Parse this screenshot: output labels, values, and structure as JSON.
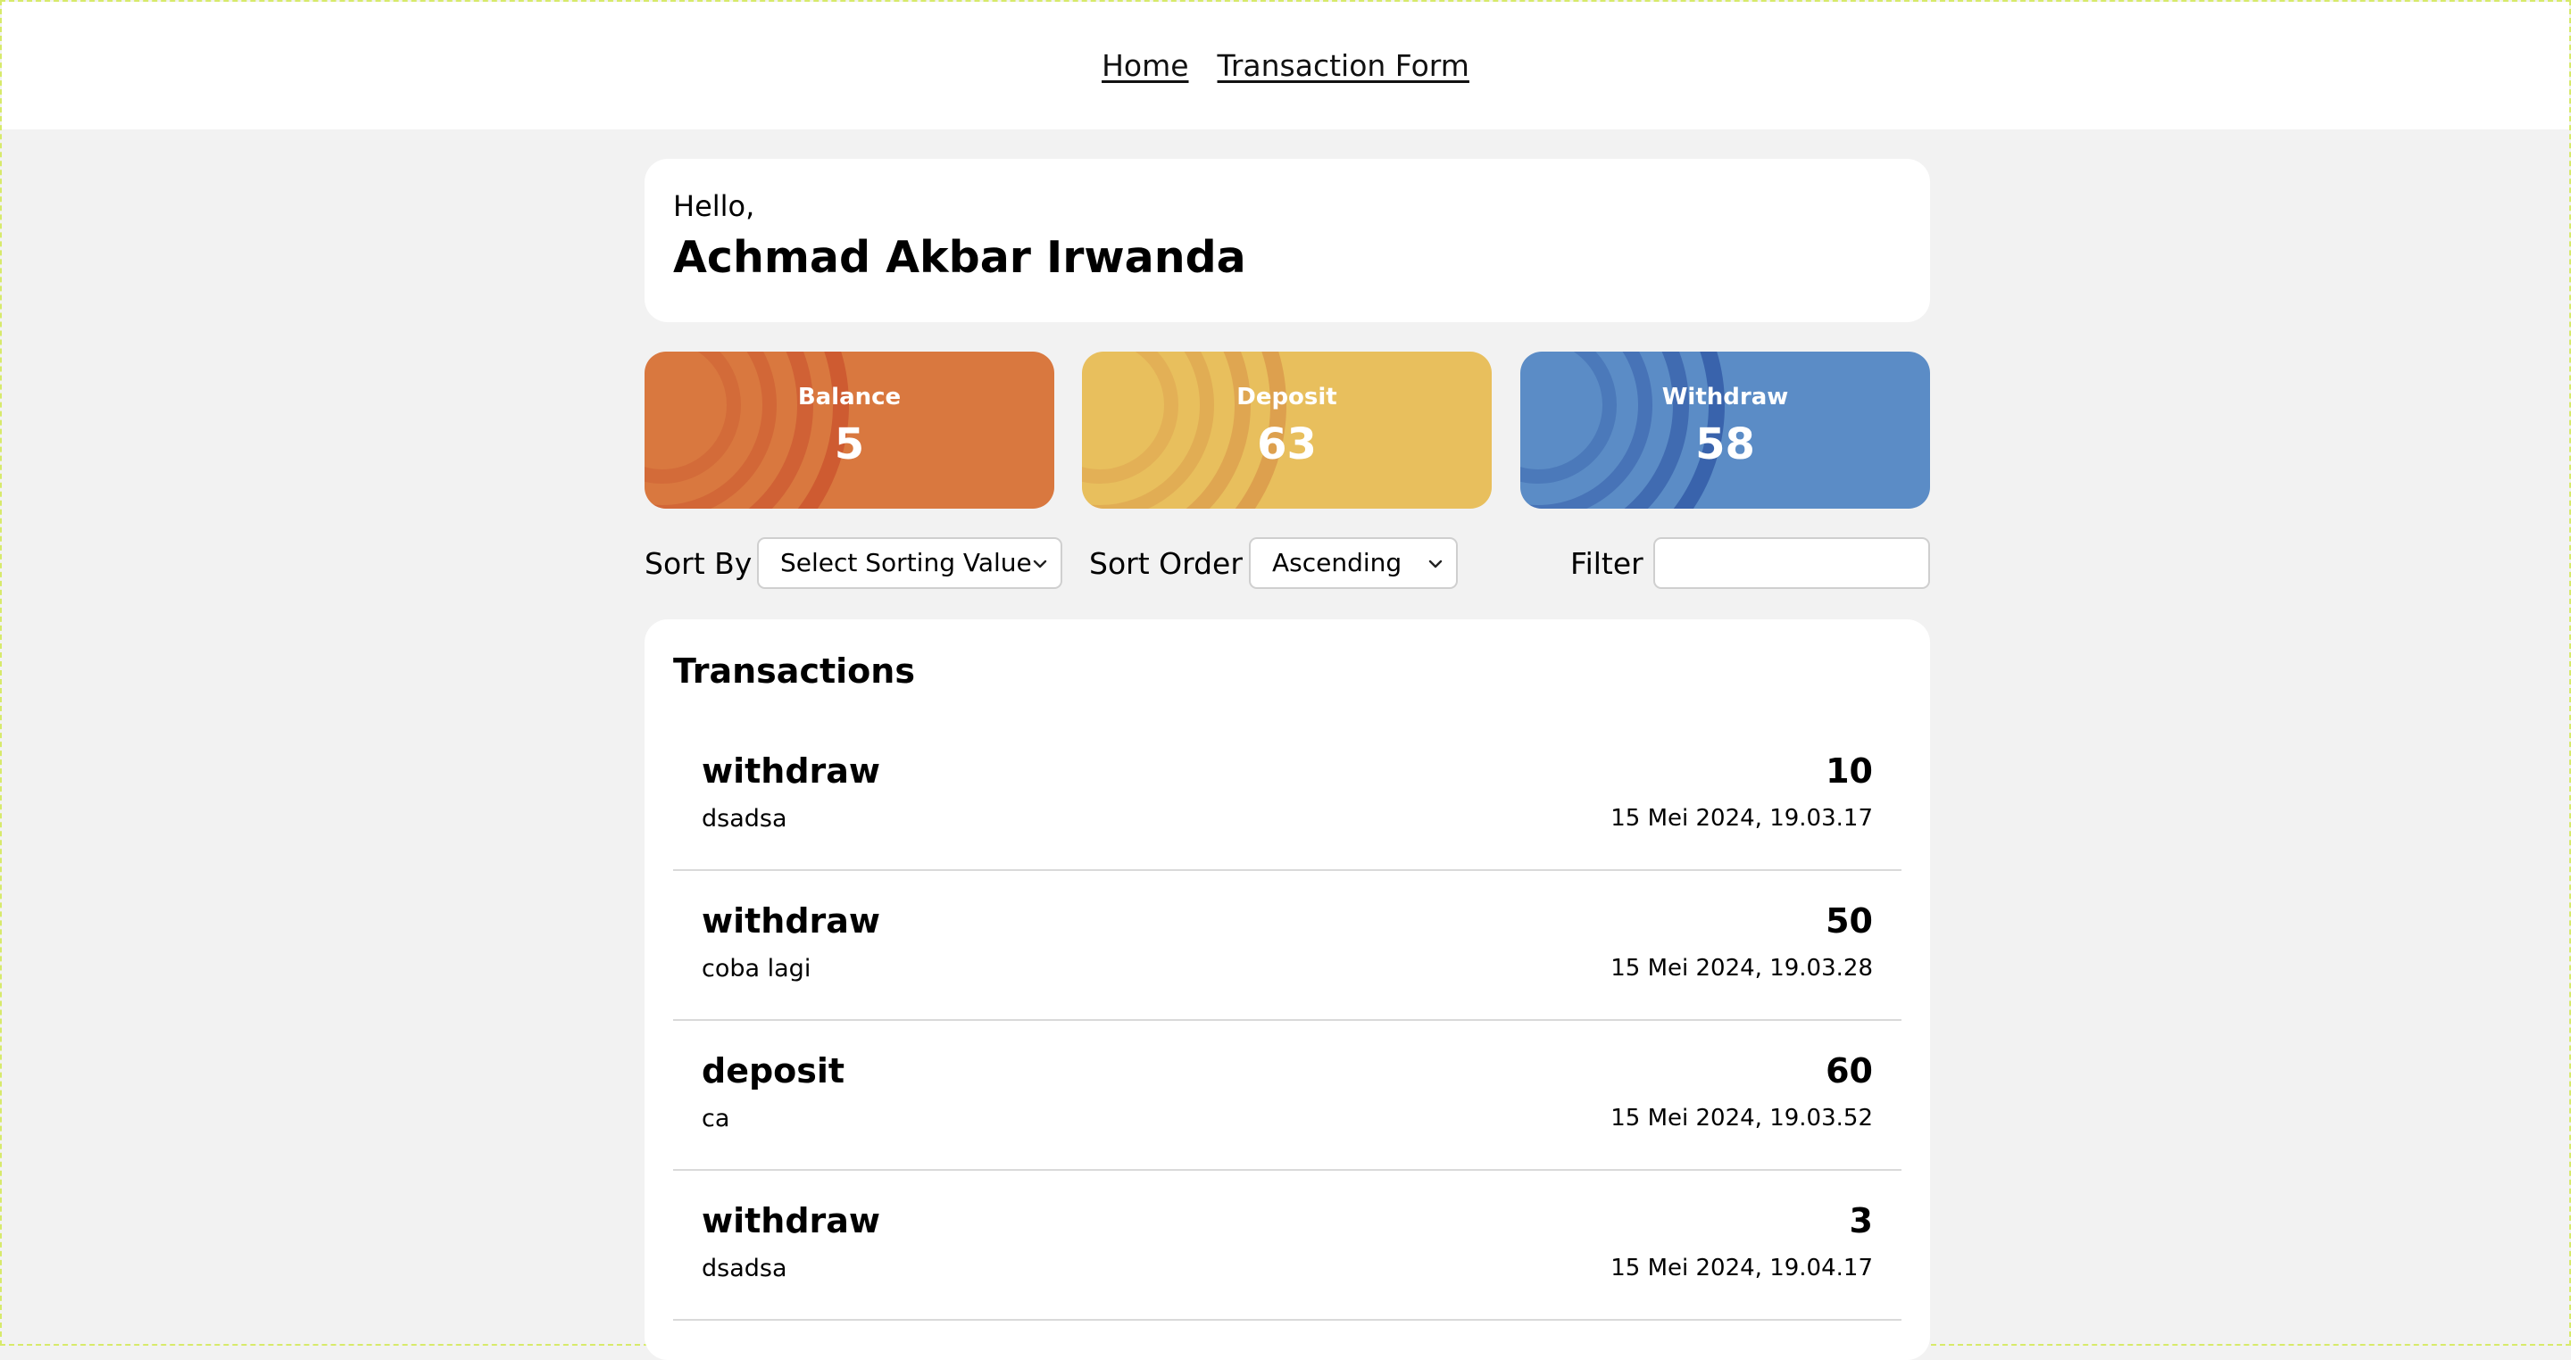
{
  "nav": {
    "home": "Home",
    "transaction_form": "Transaction Form"
  },
  "greeting": {
    "hello": "Hello,",
    "name": "Achmad Akbar Irwanda"
  },
  "stats": [
    {
      "label": "Balance",
      "value": "5",
      "color": "#d9783f",
      "accent": "#c9522e"
    },
    {
      "label": "Deposit",
      "value": "63",
      "color": "#e8bf5d",
      "accent": "#d9964a"
    },
    {
      "label": "Withdraw",
      "value": "58",
      "color": "#5b8cc6",
      "accent": "#2e55a3"
    }
  ],
  "controls": {
    "sort_by_label": "Sort By",
    "sort_by_value": "Select Sorting Value",
    "sort_order_label": "Sort Order",
    "sort_order_value": "Ascending",
    "filter_label": "Filter",
    "filter_value": ""
  },
  "transactions": {
    "title": "Transactions",
    "items": [
      {
        "type": "withdraw",
        "description": "dsadsa",
        "amount": "10",
        "date": "15 Mei 2024, 19.03.17"
      },
      {
        "type": "withdraw",
        "description": "coba lagi",
        "amount": "50",
        "date": "15 Mei 2024, 19.03.28"
      },
      {
        "type": "deposit",
        "description": "ca",
        "amount": "60",
        "date": "15 Mei 2024, 19.03.52"
      },
      {
        "type": "withdraw",
        "description": "dsadsa",
        "amount": "3",
        "date": "15 Mei 2024, 19.04.17"
      }
    ]
  }
}
